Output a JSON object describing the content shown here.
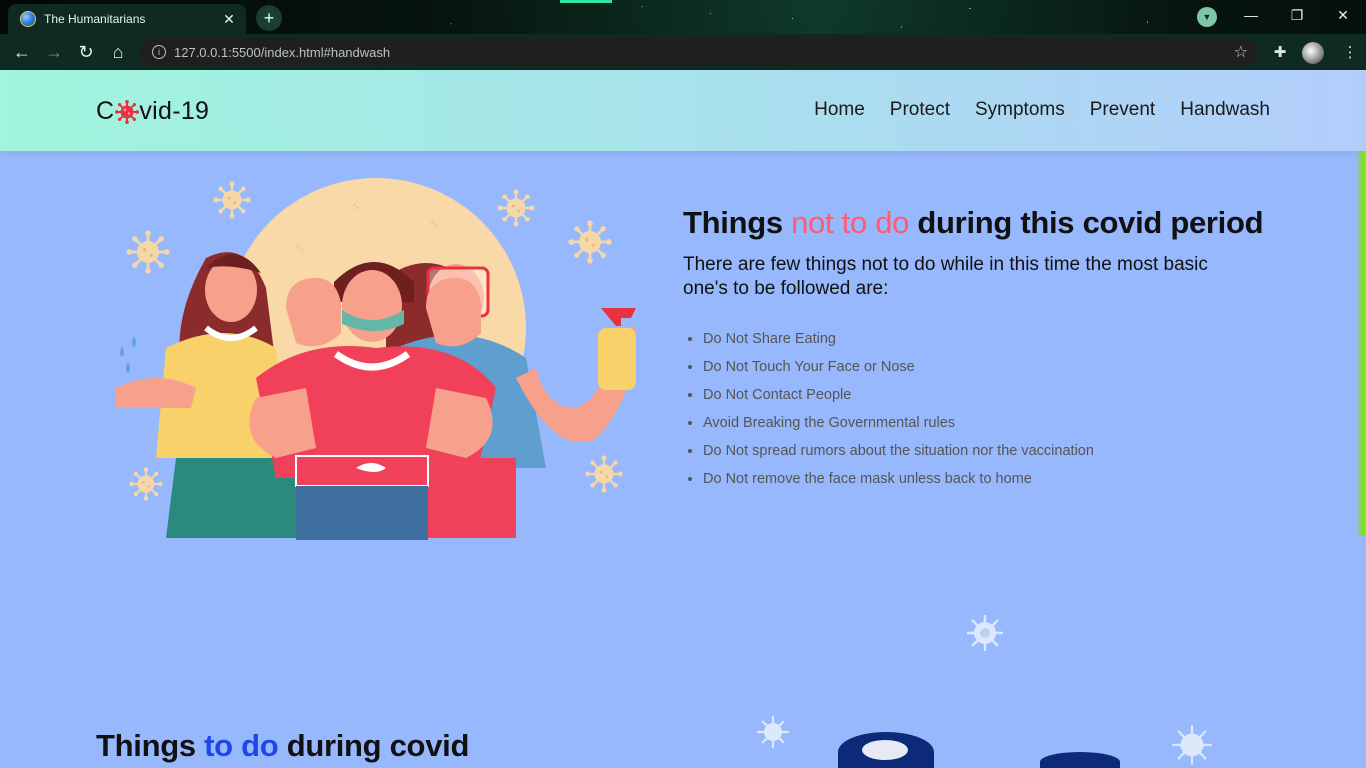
{
  "browser": {
    "tab_title": "The Humanitarians",
    "url": "127.0.0.1:5500/index.html#handwash"
  },
  "site": {
    "logo_pre": "C",
    "logo_post": "vid-19",
    "nav": [
      "Home",
      "Protect",
      "Symptoms",
      "Prevent",
      "Handwash"
    ]
  },
  "hero": {
    "title_pre": "Things ",
    "title_highlight": "not to do",
    "title_post": " during this covid period",
    "lead": "There are few things not to do while in this time the most basic one's to be followed are:",
    "items": [
      "Do Not Share Eating",
      "Do Not Touch Your Face or Nose",
      "Do Not Contact People",
      "Avoid Breaking the Governmental rules",
      "Do Not spread rumors about the situation nor the vaccination",
      "Do Not remove the face mask unless back to home"
    ]
  },
  "next_section": {
    "title_pre": "Things ",
    "title_highlight": "to do",
    "title_post": " during covid"
  },
  "colors": {
    "page_bg": "#97b8fc",
    "highlight_red": "#ff5c70",
    "highlight_blue": "#1d47e6",
    "virus_tan": "#f6d7a7"
  }
}
